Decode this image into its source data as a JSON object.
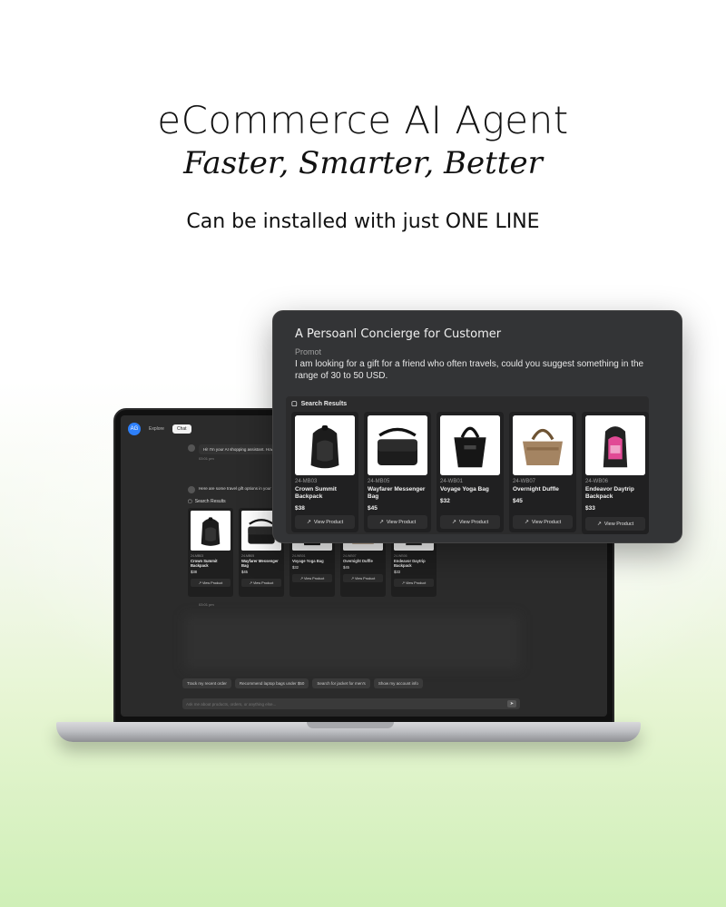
{
  "hero": {
    "title": "eCommerce AI Agent",
    "subtitle": "Faster, Smarter, Better",
    "tagline": "Can be installed with just ONE LINE"
  },
  "app": {
    "logo": "AG",
    "tabs": [
      "Explore",
      "Chat"
    ],
    "greeting": "Hi! I'm your AI shopping assistant. How can I",
    "greeting_time": "03:01 pm",
    "reply": "Here are some travel gift options in your price",
    "results_heading": "Search Results",
    "reply_time": "03:01 pm",
    "chips": [
      "Track my recent order",
      "Recommend laptop bags under $50",
      "Search for jacket for men's",
      "Show my account info"
    ],
    "input_placeholder": "Ask me about products, orders, or anything else..."
  },
  "panel": {
    "title": "A Persoanl Concierge for Customer",
    "prompt_label": "Promot",
    "prompt_text": "I am looking for a gift for a friend who often travels, could you suggest something in the range of 30 to 50 USD.",
    "results_heading": "Search Results",
    "view_label": "View Product",
    "products": [
      {
        "sku": "24-MB03",
        "name": "Crown Summit Backpack",
        "price": "$38",
        "icon": "backpack-image"
      },
      {
        "sku": "24-MB05",
        "name": "Wayfarer Messenger Bag",
        "price": "$45",
        "icon": "messenger-bag-image"
      },
      {
        "sku": "24-WB01",
        "name": "Voyage Yoga Bag",
        "price": "$32",
        "icon": "yoga-bag-image"
      },
      {
        "sku": "24-WB07",
        "name": "Overnight Duffle",
        "price": "$45",
        "icon": "duffle-image"
      },
      {
        "sku": "24-WB06",
        "name": "Endeavor Daytrip Backpack",
        "price": "$33",
        "icon": "daytrip-backpack-image"
      }
    ]
  },
  "colors": {
    "panel_bg": "#333436",
    "card_bg": "#202021",
    "accent_blue": "#2d7ff9",
    "background_green": "#cfefb7"
  }
}
